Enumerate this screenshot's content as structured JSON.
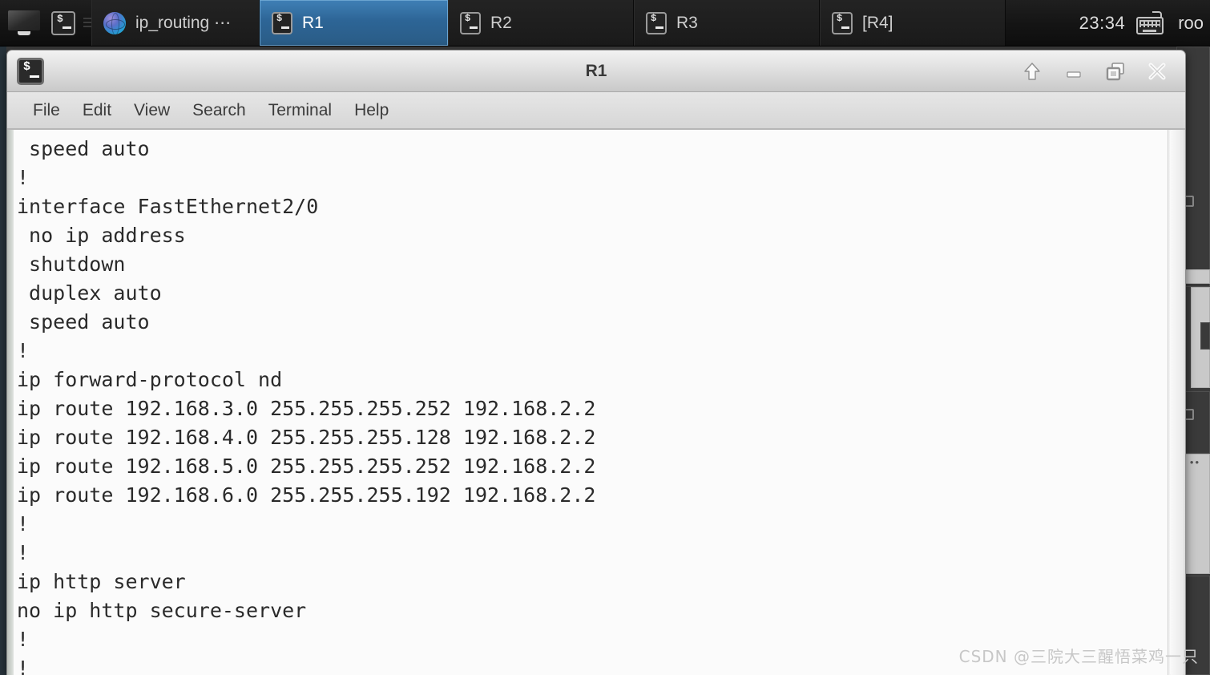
{
  "taskbar": {
    "launcher": {
      "show_desktop_label": "Show Desktop",
      "terminal_label": "Terminal"
    },
    "windows": [
      {
        "label": "ip_routing ⋯",
        "icon": "gns3-globe-icon",
        "active": false,
        "name": "taskbar-item-ip-routing"
      },
      {
        "label": "R1",
        "icon": "terminal-icon",
        "active": true,
        "name": "taskbar-item-r1"
      },
      {
        "label": "R2",
        "icon": "terminal-icon",
        "active": false,
        "name": "taskbar-item-r2"
      },
      {
        "label": "R3",
        "icon": "terminal-icon",
        "active": false,
        "name": "taskbar-item-r3"
      },
      {
        "label": "[R4]",
        "icon": "terminal-icon",
        "active": false,
        "name": "taskbar-item-r4"
      }
    ],
    "tray": {
      "clock": "23:34",
      "keyboard_icon": "keyboard-icon",
      "user": "roo"
    },
    "colors": {
      "background": "#141414",
      "active_tab": "#2d6596",
      "active_tab_border": "#6ba4d0",
      "text": "#cfcfcf"
    }
  },
  "window": {
    "title": "R1",
    "icon": "terminal-icon",
    "controls": {
      "shade": "Shade",
      "minimize": "Minimize",
      "maximize": "Maximize",
      "close": "Close"
    },
    "menu": [
      {
        "label": "File",
        "name": "menu-file"
      },
      {
        "label": "Edit",
        "name": "menu-edit"
      },
      {
        "label": "View",
        "name": "menu-view"
      },
      {
        "label": "Search",
        "name": "menu-search"
      },
      {
        "label": "Terminal",
        "name": "menu-terminal"
      },
      {
        "label": "Help",
        "name": "menu-help"
      }
    ],
    "colors": {
      "titlebar": "#e2e2e2",
      "title_text": "#3a3a3a",
      "menubar": "#d6d6d6",
      "terminal_bg": "#fbfbfb",
      "terminal_fg": "#2a2a2a"
    }
  },
  "terminal": {
    "content": " speed auto\n!\ninterface FastEthernet2/0\n no ip address\n shutdown\n duplex auto\n speed auto\n!\nip forward-protocol nd\nip route 192.168.3.0 255.255.255.252 192.168.2.2\nip route 192.168.4.0 255.255.255.128 192.168.2.2\nip route 192.168.5.0 255.255.255.252 192.168.2.2\nip route 192.168.6.0 255.255.255.192 192.168.2.2\n!\n!\nip http server\nno ip http secure-server\n!\n!",
    "lines": [
      " speed auto",
      "!",
      "interface FastEthernet2/0",
      " no ip address",
      " shutdown",
      " duplex auto",
      " speed auto",
      "!",
      "ip forward-protocol nd",
      "ip route 192.168.3.0 255.255.255.252 192.168.2.2",
      "ip route 192.168.4.0 255.255.255.128 192.168.2.2",
      "ip route 192.168.5.0 255.255.255.252 192.168.2.2",
      "ip route 192.168.6.0 255.255.255.192 192.168.2.2",
      "!",
      "!",
      "ip http server",
      "no ip http secure-server",
      "!",
      "!"
    ]
  },
  "watermark": {
    "text": "CSDN @三院大三醒悟菜鸡一只"
  }
}
